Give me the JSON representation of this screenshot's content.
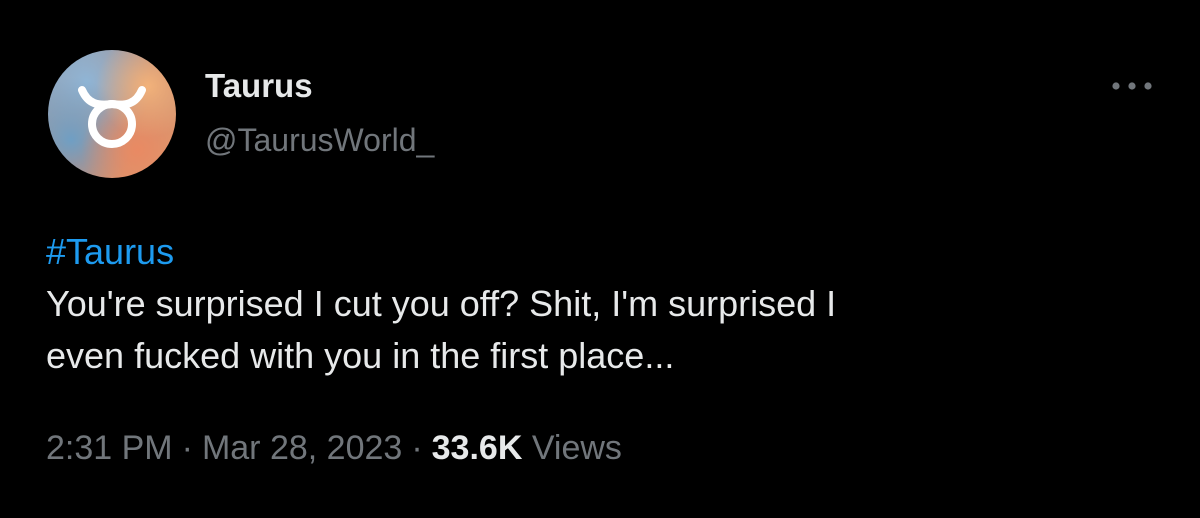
{
  "author": {
    "display_name": "Taurus",
    "handle": "@TaurusWorld_",
    "avatar_icon": "taurus-symbol-icon"
  },
  "menu": {
    "more_icon": "more-horizontal-icon"
  },
  "tweet": {
    "hashtag": "#Taurus",
    "text": "You're surprised I cut you off? Shit, I'm surprised I\neven fucked with you in the first place..."
  },
  "meta": {
    "time": "2:31 PM",
    "separator": "·",
    "date": "Mar 28, 2023",
    "views_count": "33.6K",
    "views_label": "Views"
  },
  "colors": {
    "background": "#000000",
    "primary_text": "#e7e9ea",
    "secondary_text": "#71767b",
    "link": "#1d9bf0"
  }
}
